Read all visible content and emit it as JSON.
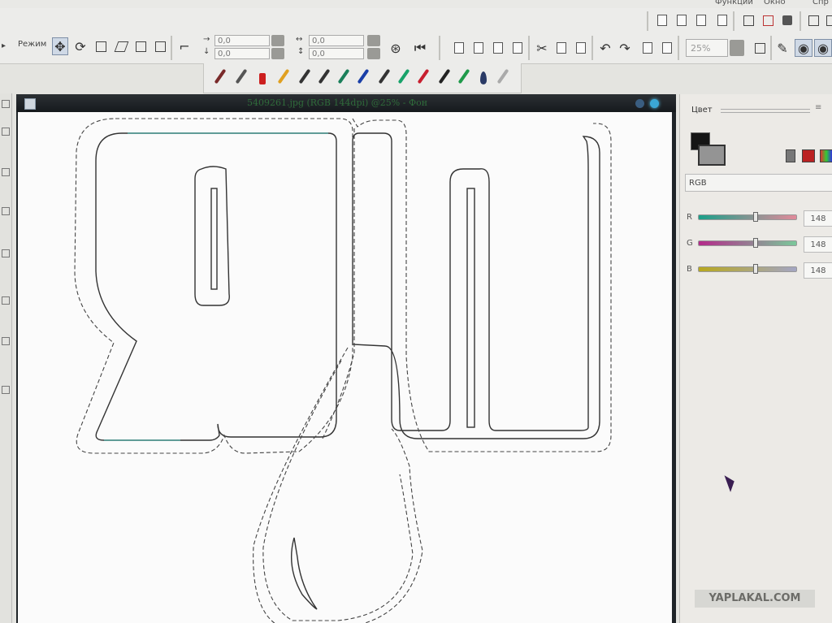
{
  "menu": {
    "item_partial_1": "Функции",
    "item_partial_2": "Окно",
    "item_partial_3": "Спр"
  },
  "toolbar_mode": {
    "mode_label": "Режим",
    "field_1": "0,0",
    "field_2": "0,0",
    "field_3": "0,0",
    "field_4": "0,0",
    "zoom": "25%"
  },
  "document": {
    "title": "5409261.jpg (RGB 144dpi) @25% - Фон"
  },
  "color_panel": {
    "title": "Цвет",
    "mode": "RGB",
    "channels": [
      {
        "label": "R",
        "value": "148",
        "level": 0.58
      },
      {
        "label": "G",
        "value": "148",
        "level": 0.58
      },
      {
        "label": "B",
        "value": "148",
        "level": 0.58
      }
    ],
    "foreground": "#151515",
    "background": "#949494"
  },
  "watermark": "YAPLAKAL.COM",
  "icons": {
    "toolbar1": [
      "mode-icon",
      "move-icon",
      "rotate-icon",
      "crop-icon",
      "flip-icon",
      "transform-icon",
      "distort-icon",
      "align-icon"
    ],
    "toolbar2": [
      "new-icon",
      "open-icon",
      "save-icon",
      "print-icon",
      "cut-icon",
      "copy-icon",
      "paste-icon",
      "undo-icon",
      "redo-icon"
    ],
    "pens": [
      "brush-icon",
      "pipette-icon",
      "eraser-icon",
      "pencil-icon",
      "marker-icon",
      "airbrush-icon",
      "calligraphy-icon",
      "drop-icon"
    ]
  }
}
